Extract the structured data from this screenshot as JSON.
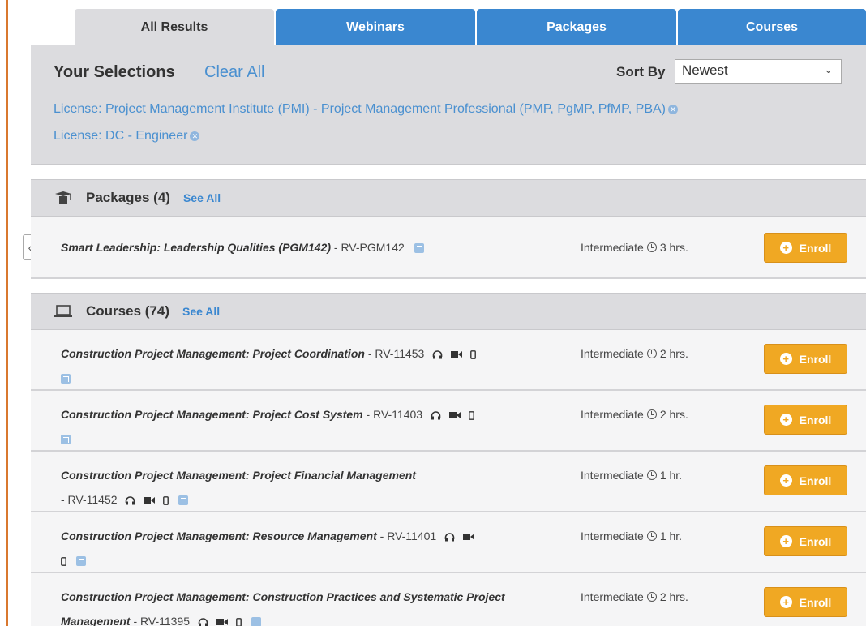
{
  "tabs": [
    {
      "label": "All Results"
    },
    {
      "label": "Webinars"
    },
    {
      "label": "Packages"
    },
    {
      "label": "Courses"
    }
  ],
  "selections": {
    "title": "Your Selections",
    "clear_all": "Clear All",
    "sort_label": "Sort By",
    "sort_value": "Newest",
    "licenses": [
      "License: Project Management Institute (PMI) - Project Management Professional (PMP, PgMP, PfMP, PBA)",
      "License: DC - Engineer"
    ]
  },
  "packages": {
    "title": "Packages (4)",
    "see_all": "See All",
    "items": [
      {
        "title": "Smart Leadership: Leadership Qualities (PGM142)",
        "code": "- RV-PGM142",
        "level": "Intermediate",
        "duration": "3 hrs.",
        "enroll": "Enroll"
      }
    ]
  },
  "courses": {
    "title": "Courses (74)",
    "see_all": "See All",
    "items": [
      {
        "title": "Construction Project Management: Project Coordination",
        "code": "- RV-11453",
        "level": "Intermediate",
        "duration": "2 hrs.",
        "enroll": "Enroll"
      },
      {
        "title": "Construction Project Management: Project Cost System",
        "code": "- RV-11403",
        "level": "Intermediate",
        "duration": "2 hrs.",
        "enroll": "Enroll"
      },
      {
        "title": "Construction Project Management: Project Financial Management",
        "code": "- RV-11452",
        "level": "Intermediate",
        "duration": "1 hr.",
        "enroll": "Enroll"
      },
      {
        "title": "Construction Project Management: Resource Management",
        "code": "- RV-11401",
        "level": "Intermediate",
        "duration": "1 hr.",
        "enroll": "Enroll"
      },
      {
        "title": "Construction Project Management: Construction Practices and Systematic Project Management",
        "code": "- RV-11395",
        "level": "Intermediate",
        "duration": "2 hrs.",
        "enroll": "Enroll"
      }
    ]
  },
  "colors": {
    "accent_blue": "#3a87d0",
    "enroll_orange": "#f0a823",
    "link_blue": "#4a90d0"
  }
}
